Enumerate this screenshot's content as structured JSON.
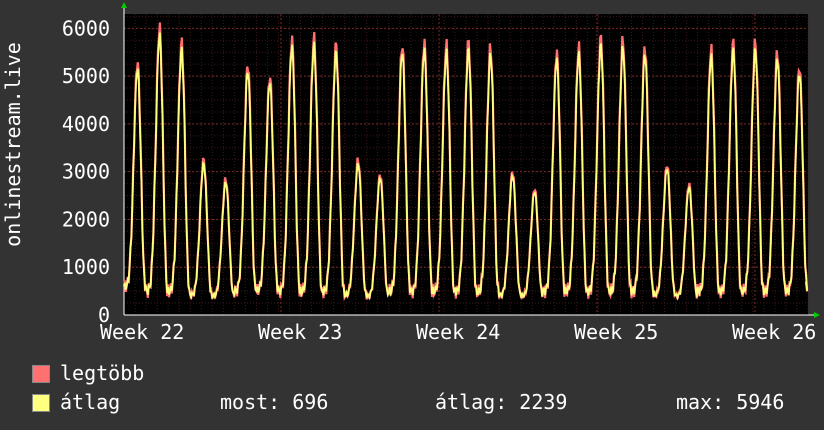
{
  "chart_data": {
    "type": "line",
    "ylabel": "onlinestream.live",
    "ylim": [
      0,
      6300
    ],
    "yticks": [
      0,
      1000,
      2000,
      3000,
      4000,
      5000,
      6000
    ],
    "x_tick_labels": [
      "Week 22",
      "Week 23",
      "Week 24",
      "Week 25",
      "Week 26"
    ],
    "grid": true,
    "colors": {
      "background": "#333333",
      "plot_bg": "#000000",
      "grid_major": "#7a2a2a",
      "axis": "#ffffff",
      "legtobb": "#ff7070",
      "atlag": "#ffff80"
    },
    "daily_peaks": [
      5300,
      6000,
      5700,
      3250,
      2850,
      5250,
      5000,
      5750,
      5800,
      5650,
      3250,
      2950,
      5650,
      5700,
      5650,
      5700,
      5600,
      3000,
      2650,
      5500,
      5600,
      5800,
      5750,
      5600,
      3150,
      2750,
      5550,
      5700,
      5700,
      5500,
      5200
    ],
    "daily_troughs": [
      600,
      500,
      500,
      420,
      400,
      500,
      520,
      500,
      500,
      500,
      420,
      400,
      500,
      500,
      500,
      500,
      480,
      420,
      400,
      500,
      500,
      500,
      500,
      500,
      420,
      400,
      500,
      500,
      500,
      500,
      500
    ],
    "last_value": 696,
    "series": [
      {
        "name": "legtöbb",
        "color": "#ff7070"
      },
      {
        "name": "átlag",
        "color": "#ffff80"
      }
    ]
  },
  "legend": {
    "legtobb_label": "legtöbb",
    "atlag_label": "átlag",
    "most_label": "most: 696",
    "avg_label": "átlag: 2239",
    "max_label": "max: 5946"
  }
}
